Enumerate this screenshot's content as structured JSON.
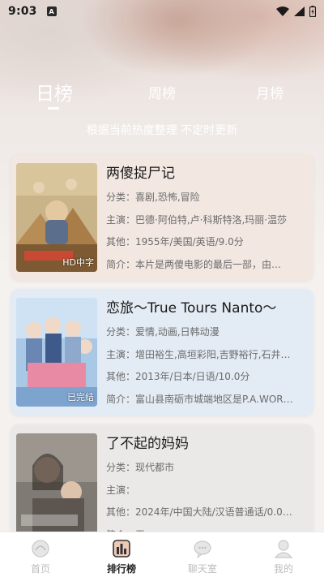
{
  "status": {
    "time": "9:03",
    "app_badge": "A"
  },
  "tabs": [
    {
      "label": "日榜",
      "active": true
    },
    {
      "label": "周榜",
      "active": false
    },
    {
      "label": "月榜",
      "active": false
    }
  ],
  "subtitle": "根据当前热度整理 不定时更新",
  "cards": [
    {
      "title": "两傻捉尸记",
      "badge": "HD中字",
      "genre": "分类：喜剧,恐怖,冒险",
      "cast": "主演：巴德·阿伯特,卢·科斯特洛,玛丽·温莎",
      "other": "其他：1955年/美国/英语/9.0分",
      "summary": "简介：本片是两傻电影的最后一部，由…",
      "bg": "#f2e7e1"
    },
    {
      "title": "恋旅～True Tours Nanto～",
      "badge": "已完结",
      "genre": "分类：爱情,动画,日韩动漫",
      "cast": "主演：增田裕生,高垣彩阳,吉野裕行,石井…",
      "other": "其他：2013年/日本/日语/10.0分",
      "summary": "简介：富山县南砺市城端地区是P.A.WOR…",
      "bg": "#e3ebf4"
    },
    {
      "title": "了不起的妈妈",
      "badge": "",
      "genre": "分类：现代都市",
      "cast": "主演：",
      "other": "其他：2024年/中国大陆/汉语普通话/0.0…",
      "summary": "简介：无",
      "bg": "#ebe9e7"
    }
  ],
  "nav": [
    {
      "label": "首页",
      "icon": "home-icon",
      "active": false
    },
    {
      "label": "排行榜",
      "icon": "ranking-icon",
      "active": true
    },
    {
      "label": "聊天室",
      "icon": "chat-icon",
      "active": false
    },
    {
      "label": "我的",
      "icon": "profile-icon",
      "active": false
    }
  ]
}
